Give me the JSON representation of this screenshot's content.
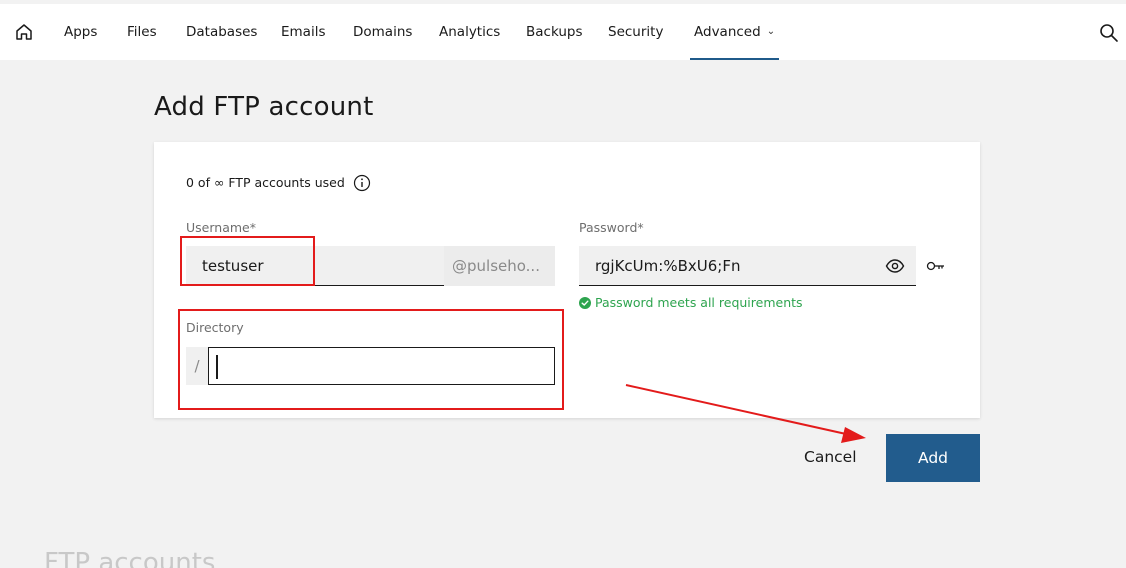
{
  "nav": {
    "items": [
      {
        "label": "Apps"
      },
      {
        "label": "Files"
      },
      {
        "label": "Databases"
      },
      {
        "label": "Emails"
      },
      {
        "label": "Domains"
      },
      {
        "label": "Analytics"
      },
      {
        "label": "Backups"
      },
      {
        "label": "Security"
      },
      {
        "label": "Advanced"
      }
    ],
    "active": "Advanced"
  },
  "page": {
    "title": "Add FTP account",
    "usage": "0 of ∞ FTP accounts used"
  },
  "form": {
    "username": {
      "label": "Username*",
      "value": "testuser",
      "suffix": "@pulseho..."
    },
    "password": {
      "label": "Password*",
      "value": "rgjKcUm:%BxU6;Fn",
      "status": "Password meets all requirements"
    },
    "directory": {
      "label": "Directory",
      "prefix": "/",
      "value": ""
    }
  },
  "actions": {
    "cancel": "Cancel",
    "add": "Add"
  },
  "section2": {
    "title": "FTP accounts"
  },
  "colors": {
    "accent": "#225c8d",
    "success": "#2ea44f",
    "annotation": "#e31b1b"
  },
  "icons": [
    "home-icon",
    "chevron-down-icon",
    "search-icon",
    "info-icon",
    "eye-icon",
    "key-icon",
    "check-circle-icon"
  ]
}
